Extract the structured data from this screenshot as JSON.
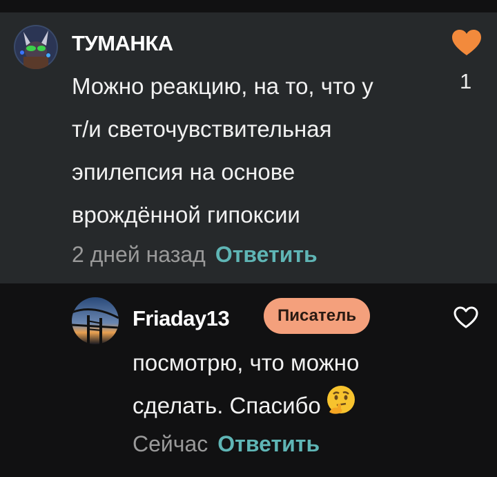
{
  "comment": {
    "username": "ТУМАНКА",
    "lines": [
      "Можно реакцию, на то, что у",
      "т/и светочувствительная",
      "эпилепсия на основе",
      "врождённой гипоксии"
    ],
    "time": "2 дней назад",
    "reply_label": "Ответить",
    "likes": "1",
    "liked": true,
    "like_color": "#f28a3c"
  },
  "reply": {
    "username": "Friaday13",
    "badge": "Писатель",
    "lines": [
      "посмотрю, что можно",
      "сделать. Спасибо"
    ],
    "emoji": "thinking-face-emoji",
    "time": "Сейчас",
    "reply_label": "Ответить",
    "liked": false
  },
  "colors": {
    "reply_accent": "#5fb5b5",
    "badge_bg": "#f4a07c"
  }
}
